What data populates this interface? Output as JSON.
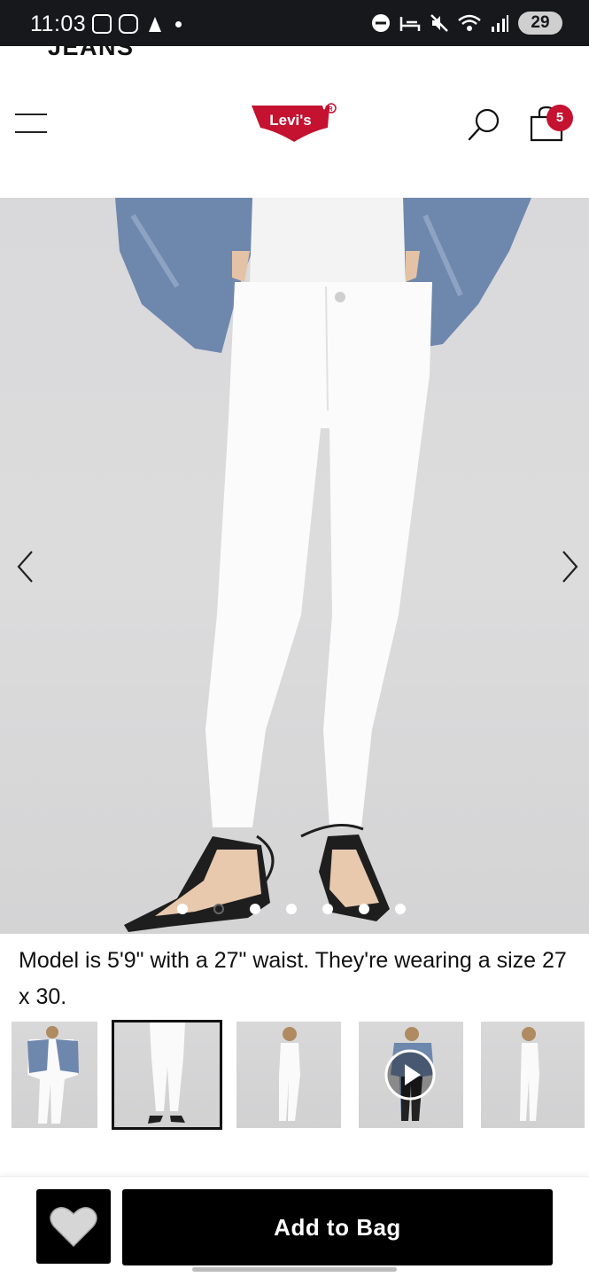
{
  "status_bar": {
    "time": "11:03",
    "battery": "29",
    "icons": [
      "screenshot-icon",
      "instagram-icon",
      "app-icon",
      "notification-dot",
      "dnd-icon",
      "sleep-icon",
      "mute-icon",
      "wifi-icon",
      "signal-icon"
    ]
  },
  "header": {
    "partial_title": "JEANS",
    "logo_text": "Levi's",
    "bag_count": "5"
  },
  "hero": {
    "active_dot": 1,
    "dot_count": 7
  },
  "product": {
    "model_caption": "Model is 5'9\" with a 27\" waist. They're wearing a size 27 x 30."
  },
  "thumbnails": {
    "selected_index": 1,
    "count": 5
  },
  "actions": {
    "add_to_bag": "Add to Bag"
  },
  "colors": {
    "brand_red": "#c41230",
    "button_black": "#000000",
    "status_bar": "#17181c"
  }
}
